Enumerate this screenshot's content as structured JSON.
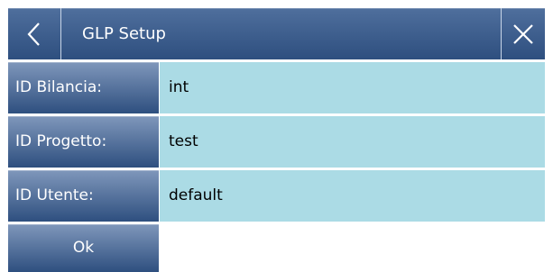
{
  "header": {
    "title": "GLP Setup",
    "back_icon": "chevron-left-icon",
    "close_icon": "close-icon"
  },
  "form": {
    "fields": [
      {
        "label": "ID Bilancia:",
        "value": "int"
      },
      {
        "label": "ID Progetto:",
        "value": "test"
      },
      {
        "label": "ID Utente:",
        "value": "default"
      }
    ]
  },
  "actions": {
    "ok_label": "Ok"
  },
  "colors": {
    "header_bg": "#2e4f7f",
    "label_bg_top": "#7f97bb",
    "field_bg": "#abdbe5"
  }
}
